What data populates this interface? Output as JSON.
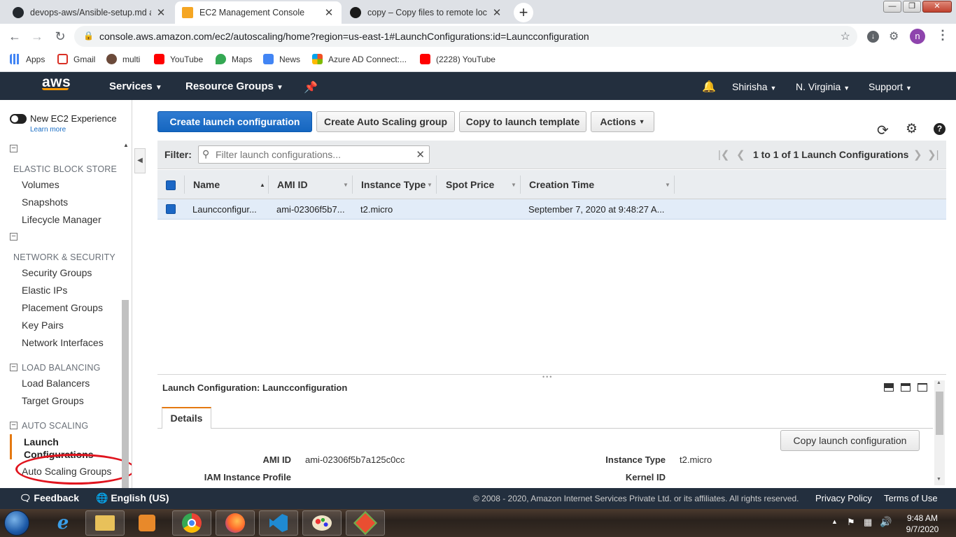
{
  "browser": {
    "tabs": [
      {
        "title": "devops-aws/Ansible-setup.md at",
        "close": "✕"
      },
      {
        "title": "EC2 Management Console",
        "close": "✕"
      },
      {
        "title": "copy – Copy files to remote locat",
        "close": "✕"
      }
    ],
    "new_tab": "+",
    "window_controls": {
      "minimize": "—",
      "maximize": "❐",
      "close": "✕"
    },
    "url": "console.aws.amazon.com/ec2/autoscaling/home?region=us-east-1#LaunchConfigurations:id=Launcconfiguration",
    "profile_initial": "n",
    "bookmarks": [
      "Apps",
      "Gmail",
      "multi",
      "YouTube",
      "Maps",
      "News",
      "Azure AD Connect:...",
      "(2228) YouTube"
    ]
  },
  "aws_nav": {
    "logo": "aws",
    "services": "Services",
    "resource_groups": "Resource Groups",
    "user": "Shirisha",
    "region": "N. Virginia",
    "support": "Support"
  },
  "sidebar": {
    "new_experience": "New EC2 Experience",
    "learn_more": "Learn more",
    "sections": [
      {
        "title": "ELASTIC BLOCK STORE",
        "items": [
          "Volumes",
          "Snapshots",
          "Lifecycle Manager"
        ]
      },
      {
        "title": "NETWORK & SECURITY",
        "items": [
          "Security Groups",
          "Elastic IPs",
          "Placement Groups",
          "Key Pairs",
          "Network Interfaces"
        ]
      },
      {
        "title": "LOAD BALANCING",
        "items": [
          "Load Balancers",
          "Target Groups"
        ]
      },
      {
        "title": "AUTO SCALING",
        "items": [
          "Launch Configurations",
          "Auto Scaling Groups"
        ]
      }
    ],
    "launch_line1": "Launch",
    "launch_line2": "Configurations"
  },
  "actions": {
    "create_launch": "Create launch configuration",
    "create_asg": "Create Auto Scaling group",
    "copy_template": "Copy to launch template",
    "actions": "Actions"
  },
  "filter": {
    "label": "Filter:",
    "placeholder": "Filter launch configurations...",
    "pagination": "1 to 1 of 1 Launch Configurations"
  },
  "table": {
    "columns": [
      "Name",
      "AMI ID",
      "Instance Type",
      "Spot Price",
      "Creation Time"
    ],
    "rows": [
      {
        "name": "Launcconfigur...",
        "ami": "ami-02306f5b7...",
        "type": "t2.micro",
        "spot": "",
        "created": "September 7, 2020 at 9:48:27 A..."
      }
    ]
  },
  "detail": {
    "title": "Launch Configuration: Launcconfiguration",
    "tab": "Details",
    "copy_button": "Copy launch configuration",
    "fields": [
      {
        "label": "AMI ID",
        "value": "ami-02306f5b7a125c0cc"
      },
      {
        "label": "Instance Type",
        "value": "t2.micro"
      },
      {
        "label": "IAM Instance Profile",
        "value": ""
      },
      {
        "label": "Kernel ID",
        "value": ""
      }
    ]
  },
  "footer": {
    "feedback": "Feedback",
    "language": "English (US)",
    "copyright": "© 2008 - 2020, Amazon Internet Services Private Ltd. or its affiliates. All rights reserved.",
    "privacy": "Privacy Policy",
    "terms": "Terms of Use"
  },
  "taskbar": {
    "time": "9:48 AM",
    "date": "9/7/2020"
  },
  "colors": {
    "aws_nav": "#232f3e",
    "primary_button": "#1566c0",
    "annotation": "#e0141e",
    "aws_orange": "#ff9900"
  }
}
